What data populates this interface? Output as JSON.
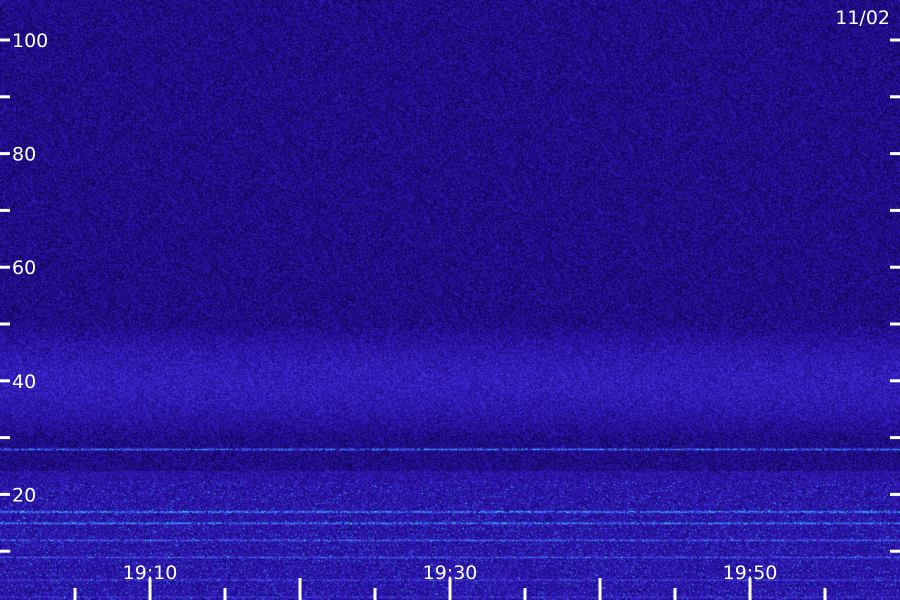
{
  "chart_data": {
    "type": "heatmap",
    "date_label": "11/02",
    "y_axis": {
      "ylim": [
        0,
        100
      ],
      "major_ticks": [
        20,
        40,
        60,
        80,
        100
      ],
      "minor_ticks": [
        10,
        30,
        50,
        70,
        90
      ],
      "tick_labels": [
        "20",
        "40",
        "60",
        "80",
        "100"
      ],
      "ticks_on_both_sides": true
    },
    "x_axis": {
      "xlim": [
        "19:00",
        "20:00"
      ],
      "tick_labels": [
        "19:10",
        "19:30",
        "19:50"
      ],
      "labeled_tick_times": [
        "19:10",
        "19:30",
        "19:50"
      ],
      "major_tick_interval_min": 10,
      "minor_tick_interval_min": 5
    },
    "colormap": [
      "#000000",
      "#17087a",
      "#3a1ec8",
      "#3d5cf2",
      "#1fb8e8",
      "#3af2a8",
      "#c8f070"
    ],
    "features": [
      {
        "name": "band-28",
        "y": 28,
        "intensity": 0.75
      },
      {
        "name": "band-17",
        "y": 17,
        "intensity": 0.85
      },
      {
        "name": "band-15",
        "y": 15,
        "intensity": 0.8
      },
      {
        "name": "band-12",
        "y": 12,
        "intensity": 0.7
      },
      {
        "name": "band-9",
        "y": 9,
        "intensity": 0.65
      },
      {
        "name": "band-5",
        "y": 5,
        "intensity": 0.6
      },
      {
        "name": "band-2",
        "y": 2,
        "intensity": 0.55
      }
    ],
    "diffuse_region": {
      "y_range": [
        30,
        50
      ],
      "intensity": 0.3
    },
    "grid": false
  }
}
